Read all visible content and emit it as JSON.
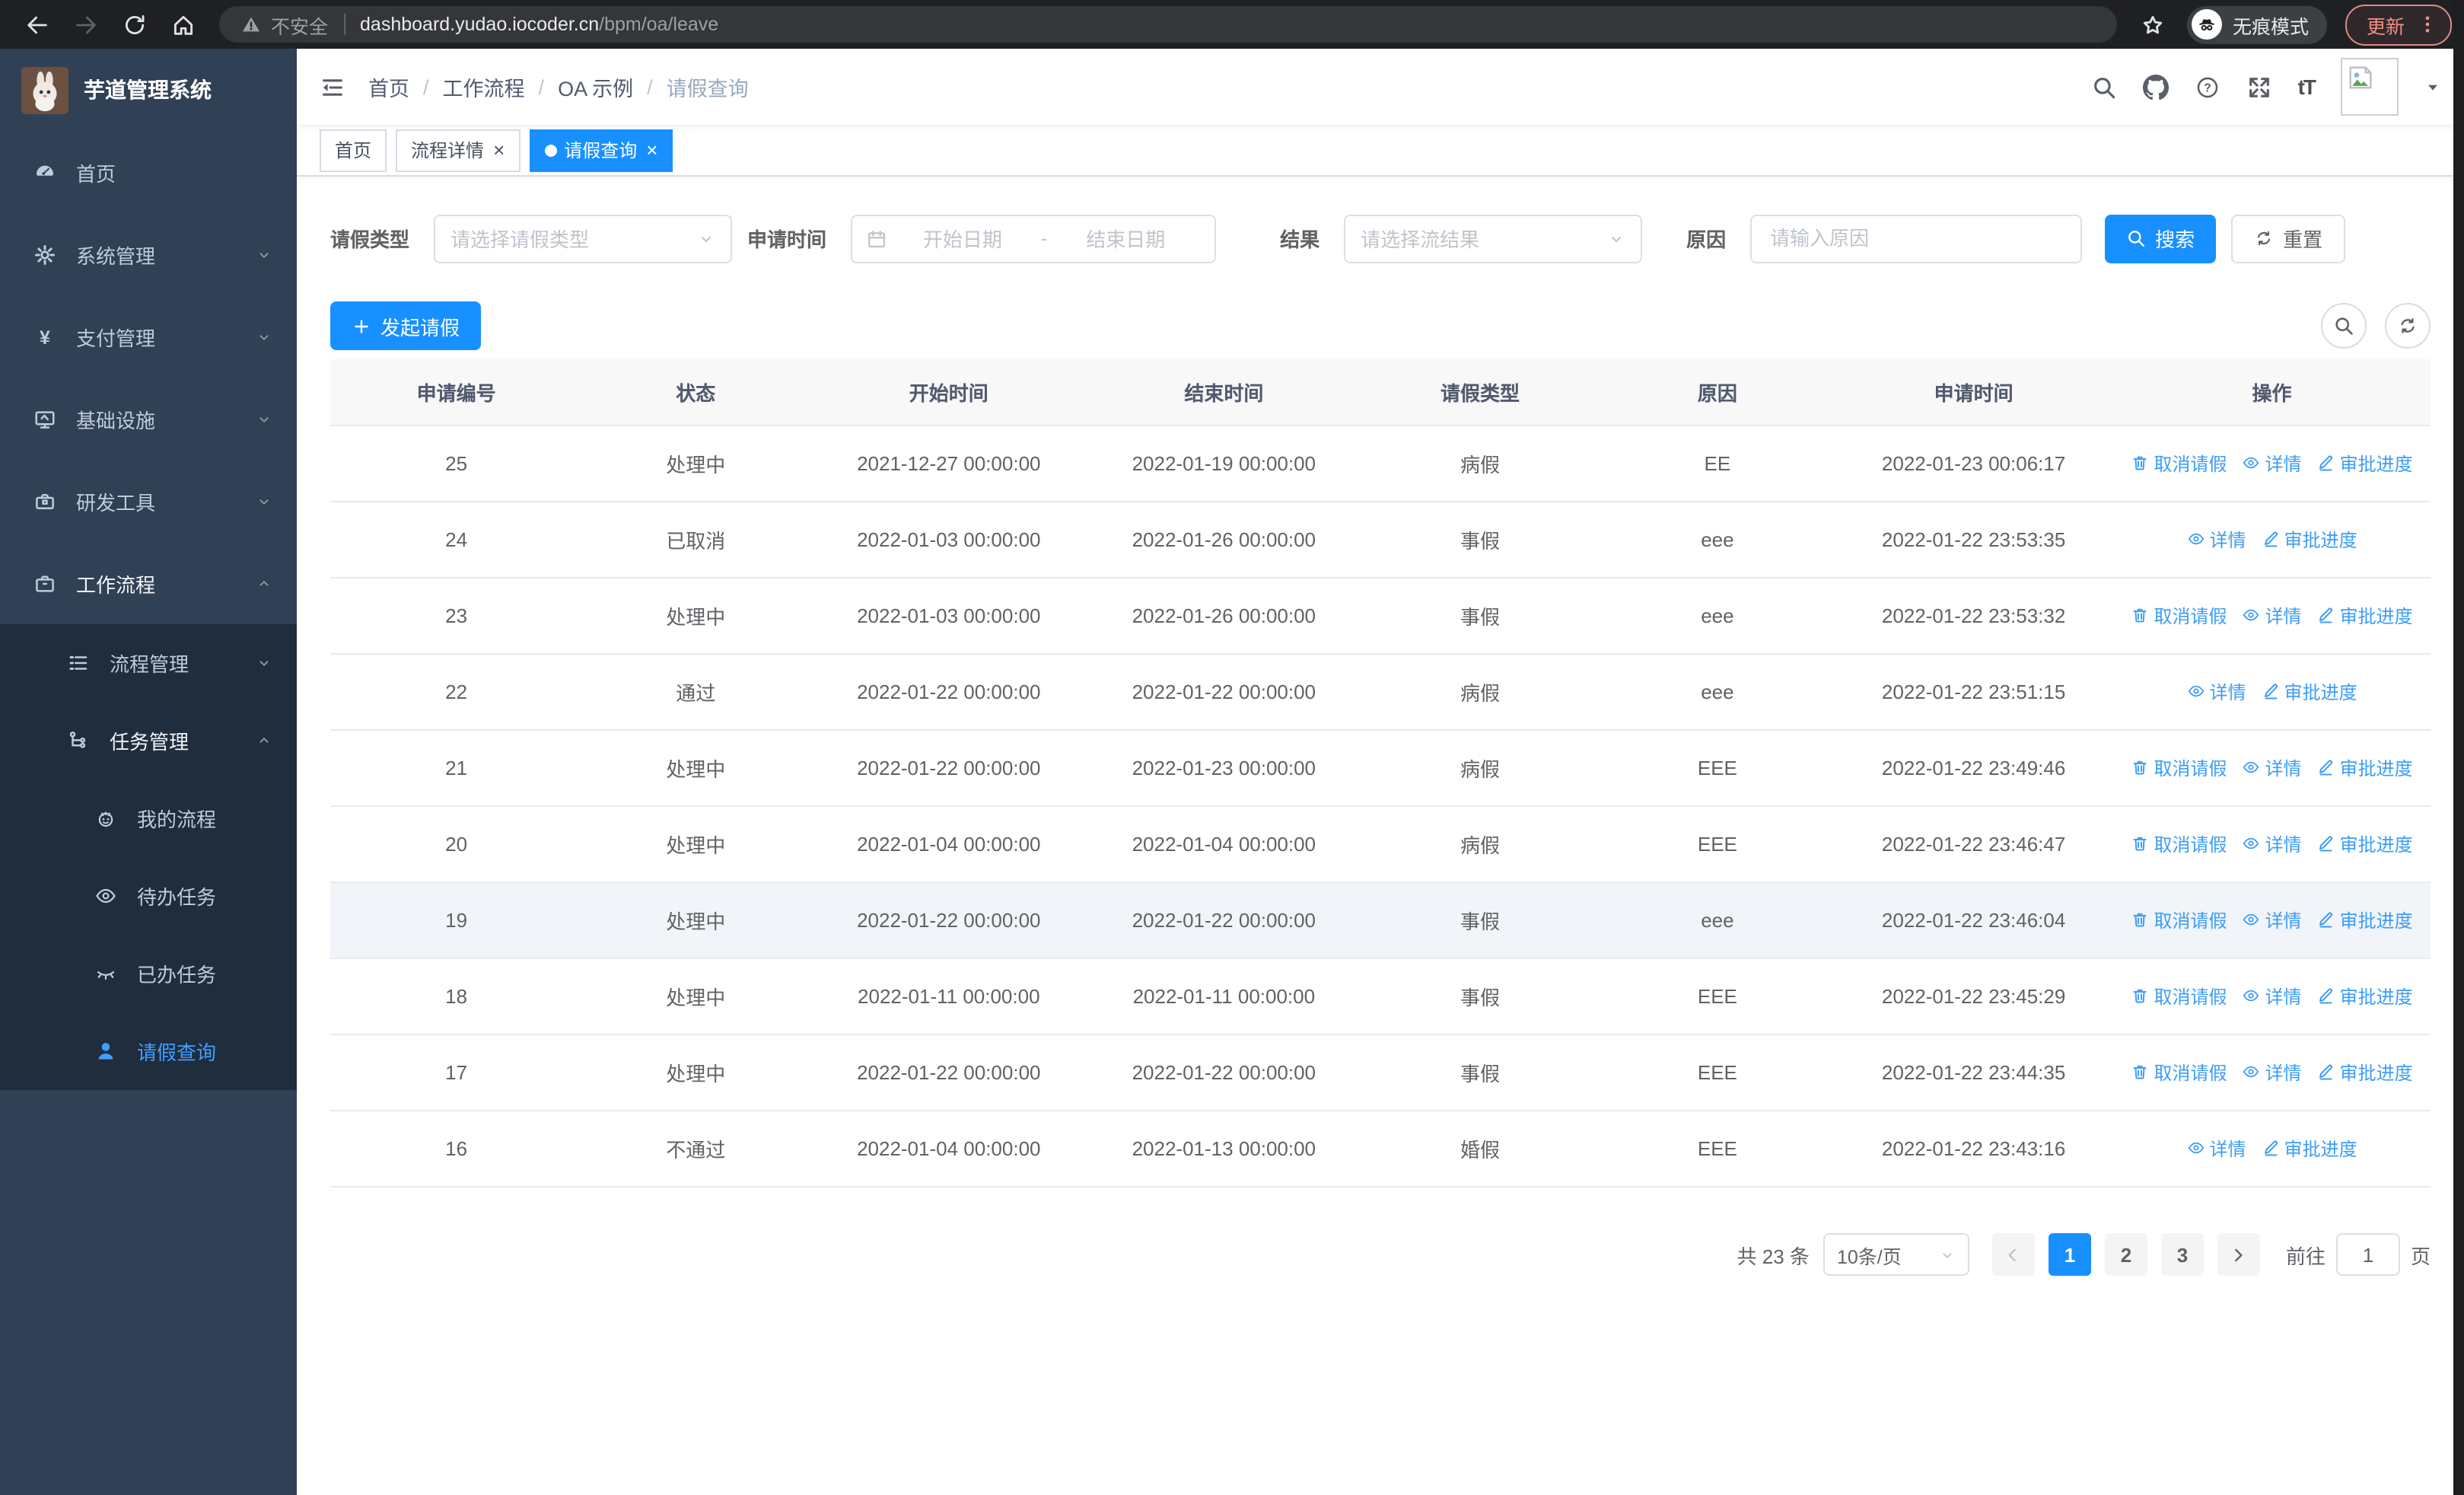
{
  "browser": {
    "security_label": "不安全",
    "url_host": "dashboard.yudao.iocoder.cn",
    "url_path": "/bpm/oa/leave",
    "incognito_label": "无痕模式",
    "update_label": "更新"
  },
  "sidebar": {
    "title": "芋道管理系统",
    "menu": [
      {
        "key": "home",
        "icon": "dashboard",
        "label": "首页",
        "level": 0
      },
      {
        "key": "system-mgmt",
        "icon": "gear",
        "label": "系统管理",
        "level": 0,
        "chevron": "down"
      },
      {
        "key": "payment-mgmt",
        "icon": "yen",
        "label": "支付管理",
        "level": 0,
        "chevron": "down"
      },
      {
        "key": "infrastructure",
        "icon": "monitor",
        "label": "基础设施",
        "level": 0,
        "chevron": "down"
      },
      {
        "key": "dev-tools",
        "icon": "toolbox",
        "label": "研发工具",
        "level": 0,
        "chevron": "down"
      },
      {
        "key": "workflow",
        "icon": "briefcase",
        "label": "工作流程",
        "level": 0,
        "chevron": "up",
        "expanded": true
      },
      {
        "key": "process-mgmt",
        "icon": "list-tree",
        "label": "流程管理",
        "level": 1,
        "chevron": "down",
        "sub": true
      },
      {
        "key": "task-mgmt",
        "icon": "flow-tree",
        "label": "任务管理",
        "level": 1,
        "chevron": "up",
        "sub": true,
        "expanded": true
      },
      {
        "key": "my-process",
        "icon": "robot",
        "label": "我的流程",
        "level": 2,
        "sub": true
      },
      {
        "key": "todo-tasks",
        "icon": "eye",
        "label": "待办任务",
        "level": 2,
        "sub": true
      },
      {
        "key": "done-tasks",
        "icon": "eye-closed",
        "label": "已办任务",
        "level": 2,
        "sub": true
      },
      {
        "key": "leave-query",
        "icon": "user",
        "label": "请假查询",
        "level": 2,
        "sub": true,
        "active": true
      }
    ]
  },
  "header": {
    "breadcrumb": {
      "items": [
        "首页",
        "工作流程",
        "OA 示例",
        "请假查询"
      ],
      "separator": "/"
    },
    "tabs": [
      {
        "key": "home",
        "label": "首页",
        "closable": false,
        "active": false
      },
      {
        "key": "process-detail",
        "label": "流程详情",
        "closable": true,
        "active": false
      },
      {
        "key": "leave-query",
        "label": "请假查询",
        "closable": true,
        "active": true
      }
    ],
    "close_glyph": "×",
    "font_size_glyph": "tT"
  },
  "filters": {
    "leave_type_label": "请假类型",
    "leave_type_placeholder": "请选择请假类型",
    "apply_time_label": "申请时间",
    "date_start_placeholder": "开始日期",
    "date_separator": "-",
    "date_end_placeholder": "结束日期",
    "result_label": "结果",
    "result_placeholder": "请选择流结果",
    "reason_label": "原因",
    "reason_placeholder": "请输入原因",
    "search_button": "搜索",
    "reset_button": "重置"
  },
  "toolbar": {
    "create_button": "发起请假"
  },
  "table": {
    "columns": [
      "申请编号",
      "状态",
      "开始时间",
      "结束时间",
      "请假类型",
      "原因",
      "申请时间",
      "操作"
    ],
    "action_labels": {
      "cancel": "取消请假",
      "detail": "详情",
      "progress": "审批进度"
    },
    "rows": [
      {
        "id": "25",
        "status": "处理中",
        "start": "2021-12-27 00:00:00",
        "end": "2022-01-19 00:00:00",
        "type": "病假",
        "reason": "EE",
        "applied": "2022-01-23 00:06:17",
        "actions": [
          "cancel",
          "detail",
          "progress"
        ],
        "highlight": false
      },
      {
        "id": "24",
        "status": "已取消",
        "start": "2022-01-03 00:00:00",
        "end": "2022-01-26 00:00:00",
        "type": "事假",
        "reason": "eee",
        "applied": "2022-01-22 23:53:35",
        "actions": [
          "detail",
          "progress"
        ],
        "highlight": false
      },
      {
        "id": "23",
        "status": "处理中",
        "start": "2022-01-03 00:00:00",
        "end": "2022-01-26 00:00:00",
        "type": "事假",
        "reason": "eee",
        "applied": "2022-01-22 23:53:32",
        "actions": [
          "cancel",
          "detail",
          "progress"
        ],
        "highlight": false
      },
      {
        "id": "22",
        "status": "通过",
        "start": "2022-01-22 00:00:00",
        "end": "2022-01-22 00:00:00",
        "type": "病假",
        "reason": "eee",
        "applied": "2022-01-22 23:51:15",
        "actions": [
          "detail",
          "progress"
        ],
        "highlight": false
      },
      {
        "id": "21",
        "status": "处理中",
        "start": "2022-01-22 00:00:00",
        "end": "2022-01-23 00:00:00",
        "type": "病假",
        "reason": "EEE",
        "applied": "2022-01-22 23:49:46",
        "actions": [
          "cancel",
          "detail",
          "progress"
        ],
        "highlight": false
      },
      {
        "id": "20",
        "status": "处理中",
        "start": "2022-01-04 00:00:00",
        "end": "2022-01-04 00:00:00",
        "type": "病假",
        "reason": "EEE",
        "applied": "2022-01-22 23:46:47",
        "actions": [
          "cancel",
          "detail",
          "progress"
        ],
        "highlight": false
      },
      {
        "id": "19",
        "status": "处理中",
        "start": "2022-01-22 00:00:00",
        "end": "2022-01-22 00:00:00",
        "type": "事假",
        "reason": "eee",
        "applied": "2022-01-22 23:46:04",
        "actions": [
          "cancel",
          "detail",
          "progress"
        ],
        "highlight": true
      },
      {
        "id": "18",
        "status": "处理中",
        "start": "2022-01-11 00:00:00",
        "end": "2022-01-11 00:00:00",
        "type": "事假",
        "reason": "EEE",
        "applied": "2022-01-22 23:45:29",
        "actions": [
          "cancel",
          "detail",
          "progress"
        ],
        "highlight": false
      },
      {
        "id": "17",
        "status": "处理中",
        "start": "2022-01-22 00:00:00",
        "end": "2022-01-22 00:00:00",
        "type": "事假",
        "reason": "EEE",
        "applied": "2022-01-22 23:44:35",
        "actions": [
          "cancel",
          "detail",
          "progress"
        ],
        "highlight": false
      },
      {
        "id": "16",
        "status": "不通过",
        "start": "2022-01-04 00:00:00",
        "end": "2022-01-13 00:00:00",
        "type": "婚假",
        "reason": "EEE",
        "applied": "2022-01-22 23:43:16",
        "actions": [
          "detail",
          "progress"
        ],
        "highlight": false
      }
    ]
  },
  "pagination": {
    "total_text": "共 23 条",
    "page_size": "10条/页",
    "pages": [
      {
        "label": "1",
        "active": true
      },
      {
        "label": "2",
        "active": false
      },
      {
        "label": "3",
        "active": false
      }
    ],
    "goto_label": "前往",
    "goto_value": "1",
    "goto_suffix": "页"
  }
}
